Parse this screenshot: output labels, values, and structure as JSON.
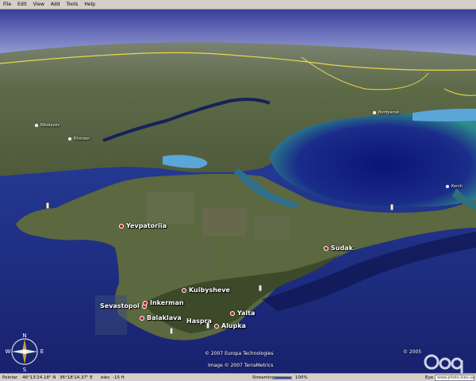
{
  "menu": {
    "items": [
      "File",
      "Edit",
      "View",
      "Add",
      "Tools",
      "Help"
    ]
  },
  "cities": {
    "yevpatoriia": "Yevpatoriia",
    "sudak": "Sudak",
    "kuibysheve": "Kuibysheve",
    "sevastopol": "Sevastopol",
    "inkerman": "Inkerman",
    "balaklava": "Balaklava",
    "haspra": "Haspra",
    "yalta": "Yalta",
    "alupka": "Alupka",
    "mykolaiv": "Nikolayev",
    "kherson": "Kherson",
    "berdyansk": "Berdyansk",
    "kerch": "Kerch"
  },
  "copyright": {
    "europa": "© 2007 Europa Technologies",
    "terrametrics": "Image © 2007 TerraMetrics",
    "year": "© 2005"
  },
  "compass": {
    "n": "N",
    "s": "S",
    "e": "E",
    "w": "W"
  },
  "status": {
    "pointer_label": "Pointer",
    "pointer_lat": "46°13'24.18\" N",
    "pointer_lon": "36°18'14.37\" E",
    "elev_label": "elev",
    "elev_value": "-15 ft",
    "streaming_label": "Streaming",
    "streaming_value": "100%",
    "eye_label": "Eye",
    "eye_box": "www.photo.kiev.ua"
  },
  "colors": {
    "sea": "#1c2d86",
    "land": "#5e6a48",
    "sky": "#6a6eb8",
    "sea_shallow": "#2e8a8a",
    "city_dot": "#c02020"
  }
}
